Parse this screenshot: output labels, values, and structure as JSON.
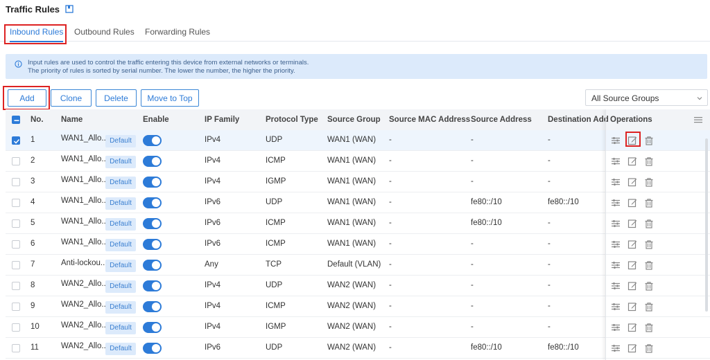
{
  "header": {
    "title": "Traffic Rules"
  },
  "tabs": [
    {
      "label": "Inbound Rules",
      "active": true
    },
    {
      "label": "Outbound Rules",
      "active": false
    },
    {
      "label": "Forwarding Rules",
      "active": false
    }
  ],
  "info": {
    "line1": "Input rules are used to control the traffic entering this device from external networks or terminals.",
    "line2": "The priority of rules is sorted by serial number. The lower the number, the higher the priority."
  },
  "toolbar": {
    "add": "Add",
    "clone": "Clone",
    "delete": "Delete",
    "move_to_top": "Move to Top"
  },
  "source_filter": {
    "value": "All Source Groups"
  },
  "columns": [
    "No.",
    "Name",
    "Enable",
    "IP Family",
    "Protocol Type",
    "Source Group",
    "Source MAC Address",
    "Source Address",
    "Destination Add",
    "Operations"
  ],
  "default_tag": "Default",
  "rows": [
    {
      "no": "1",
      "name": "WAN1_Allo...",
      "ip_family": "IPv4",
      "protocol": "UDP",
      "source_group": "WAN1 (WAN)",
      "src_mac": "-",
      "src_addr": "-",
      "dst_addr": "-",
      "selected": true
    },
    {
      "no": "2",
      "name": "WAN1_Allo...",
      "ip_family": "IPv4",
      "protocol": "ICMP",
      "source_group": "WAN1 (WAN)",
      "src_mac": "-",
      "src_addr": "-",
      "dst_addr": "-",
      "selected": false
    },
    {
      "no": "3",
      "name": "WAN1_Allo...",
      "ip_family": "IPv4",
      "protocol": "IGMP",
      "source_group": "WAN1 (WAN)",
      "src_mac": "-",
      "src_addr": "-",
      "dst_addr": "-",
      "selected": false
    },
    {
      "no": "4",
      "name": "WAN1_Allo...",
      "ip_family": "IPv6",
      "protocol": "UDP",
      "source_group": "WAN1 (WAN)",
      "src_mac": "-",
      "src_addr": "fe80::/10",
      "dst_addr": "fe80::/10",
      "selected": false
    },
    {
      "no": "5",
      "name": "WAN1_Allo...",
      "ip_family": "IPv6",
      "protocol": "ICMP",
      "source_group": "WAN1 (WAN)",
      "src_mac": "-",
      "src_addr": "fe80::/10",
      "dst_addr": "-",
      "selected": false
    },
    {
      "no": "6",
      "name": "WAN1_Allo...",
      "ip_family": "IPv6",
      "protocol": "ICMP",
      "source_group": "WAN1 (WAN)",
      "src_mac": "-",
      "src_addr": "-",
      "dst_addr": "-",
      "selected": false
    },
    {
      "no": "7",
      "name": "Anti-lockou...",
      "ip_family": "Any",
      "protocol": "TCP",
      "source_group": "Default (VLAN)",
      "src_mac": "-",
      "src_addr": "-",
      "dst_addr": "-",
      "selected": false
    },
    {
      "no": "8",
      "name": "WAN2_Allo...",
      "ip_family": "IPv4",
      "protocol": "UDP",
      "source_group": "WAN2 (WAN)",
      "src_mac": "-",
      "src_addr": "-",
      "dst_addr": "-",
      "selected": false
    },
    {
      "no": "9",
      "name": "WAN2_Allo...",
      "ip_family": "IPv4",
      "protocol": "ICMP",
      "source_group": "WAN2 (WAN)",
      "src_mac": "-",
      "src_addr": "-",
      "dst_addr": "-",
      "selected": false
    },
    {
      "no": "10",
      "name": "WAN2_Allo...",
      "ip_family": "IPv4",
      "protocol": "IGMP",
      "source_group": "WAN2 (WAN)",
      "src_mac": "-",
      "src_addr": "-",
      "dst_addr": "-",
      "selected": false
    },
    {
      "no": "11",
      "name": "WAN2_Allo...",
      "ip_family": "IPv6",
      "protocol": "UDP",
      "source_group": "WAN2 (WAN)",
      "src_mac": "-",
      "src_addr": "fe80::/10",
      "dst_addr": "fe80::/10",
      "selected": false
    }
  ],
  "colors": {
    "accent": "#2d7bd8",
    "highlight": "#dd2222",
    "info_bg": "#dceafb"
  }
}
